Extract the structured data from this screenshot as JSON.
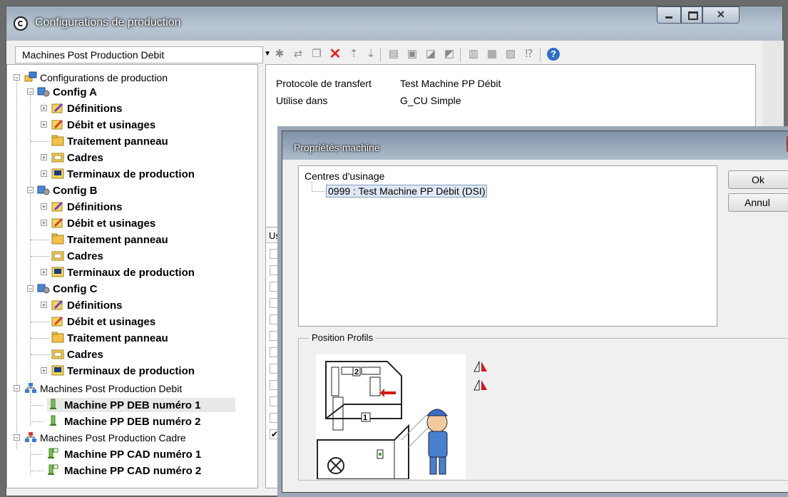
{
  "window": {
    "title": "Configurations de production"
  },
  "toolbar": {
    "combo_value": "Machines Post Production Debit"
  },
  "tree": {
    "root": "Configurations de production",
    "config_a": "Config A",
    "config_b": "Config B",
    "config_c": "Config C",
    "definitions": "Définitions",
    "debit": "Débit et usinages",
    "traitement": "Traitement panneau",
    "cadres": "Cadres",
    "terminaux": "Terminaux de production",
    "mpp_debit": "Machines Post Production Debit",
    "deb1": "Machine PP DEB numéro 1",
    "deb2": "Machine PP DEB numéro 2",
    "mpp_cadre": "Machines Post Production Cadre",
    "cad1": "Machine PP CAD numéro 1",
    "cad2": "Machine PP CAD numéro 2"
  },
  "details": {
    "protocol_label": "Protocole de transfert",
    "protocol_value": "Test Machine PP Débit",
    "used_label": "Utilise dans",
    "used_value": "G_CU Simple"
  },
  "grid": {
    "header": "Usi"
  },
  "dialog": {
    "title": "Propriétés machine",
    "list_title": "Centres d'usinage",
    "list_item": "0999 : Test Machine PP Débit (DSI)",
    "ok": "Ok",
    "cancel": "Annul",
    "position_legend": "Position Profils"
  }
}
